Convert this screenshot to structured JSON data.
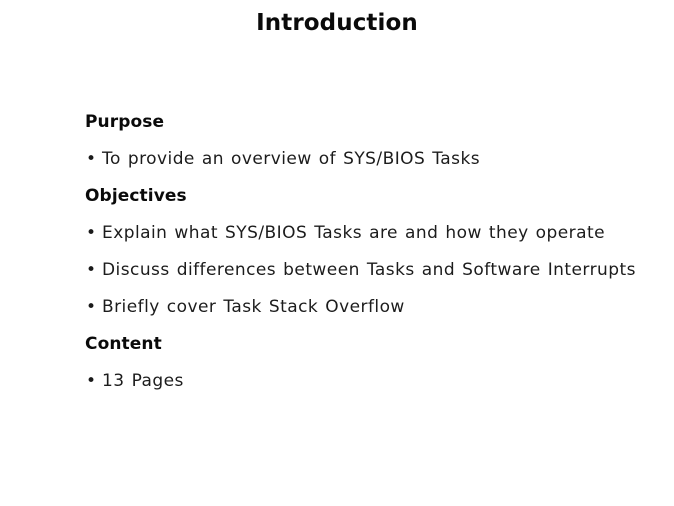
{
  "slide": {
    "title": "Introduction",
    "background_color": "#ffffff",
    "text_color": "#000000",
    "bullet_glyph": "•",
    "sections": [
      {
        "heading": "Purpose",
        "bullets": [
          "To provide an overview of SYS/BIOS Tasks"
        ]
      },
      {
        "heading": "Objectives",
        "bullets": [
          "Explain what SYS/BIOS Tasks are and how they operate",
          "Discuss differences between Tasks and Software Interrupts",
          "Briefly cover Task Stack Overflow"
        ]
      },
      {
        "heading": "Content",
        "bullets": [
          "13 Pages"
        ]
      }
    ]
  }
}
